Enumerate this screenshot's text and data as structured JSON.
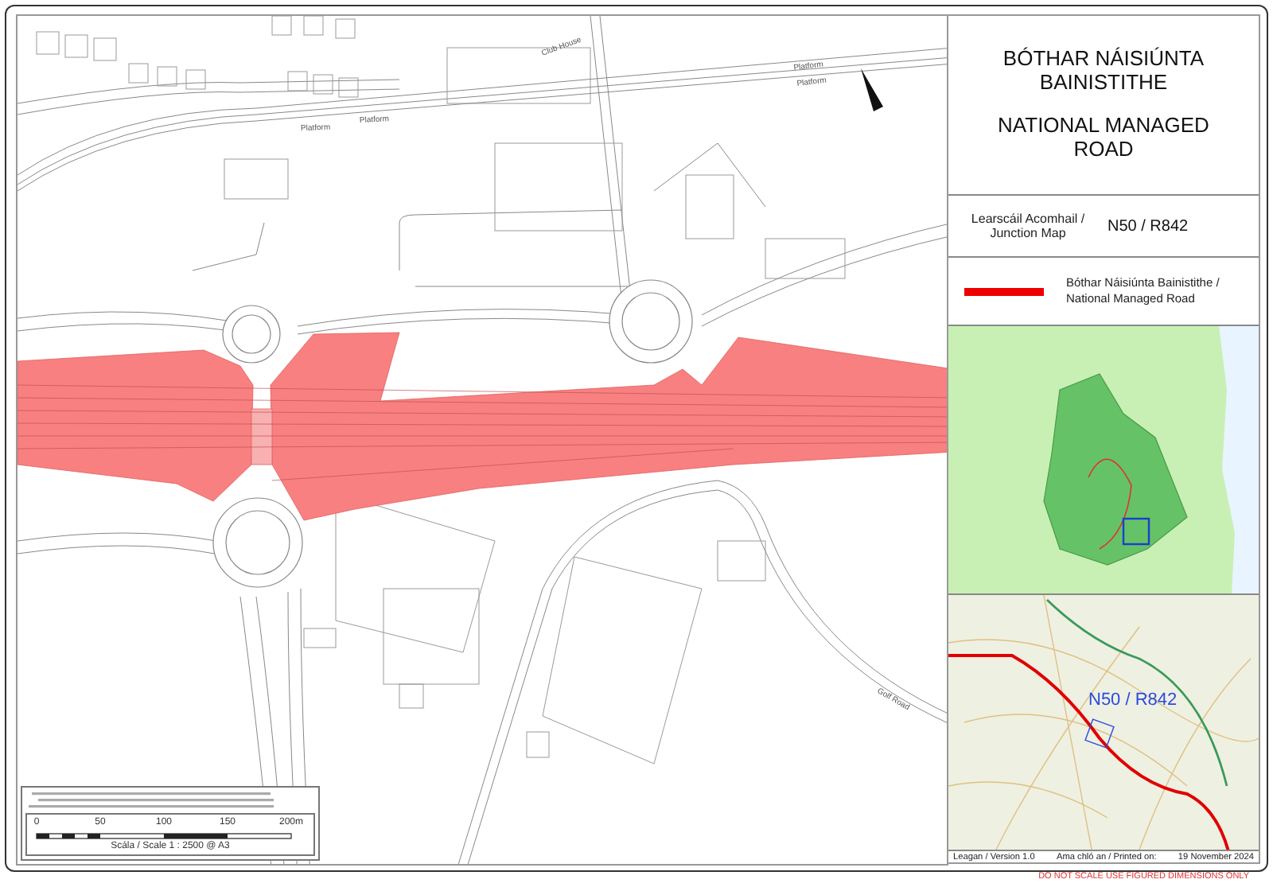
{
  "map": {
    "labels": [
      {
        "text": "Platform"
      },
      {
        "text": "Platform"
      },
      {
        "text": "Platform"
      },
      {
        "text": "Platform"
      },
      {
        "text": "Club House"
      },
      {
        "text": "Golf Road"
      }
    ],
    "scale_bar": {
      "ticks": [
        "0",
        "50",
        "100",
        "150",
        "200m"
      ],
      "caption": "Scála / Scale 1 : 2500 @ A3"
    }
  },
  "title_block": {
    "irish_title": "BÓTHAR NÁISIÚNTA BAINISTITHE",
    "english_title": "NATIONAL MANAGED ROAD"
  },
  "junction": {
    "label": "Learscáil Acomhail / Junction  Map",
    "code": "N50 / R842"
  },
  "legend": {
    "label": "Bóthar Náisiúnta Bainistithe / National Managed Road"
  },
  "overview_map": {
    "label": "N50 / R842"
  },
  "footer": {
    "version": "Leagan / Version 1.0",
    "printed_label": "Ama chló an / Printed on:",
    "printed_date": "19 November 2024"
  },
  "disclaimer": "DO NOT SCALE USE FIGURED DIMENSIONS ONLY"
}
